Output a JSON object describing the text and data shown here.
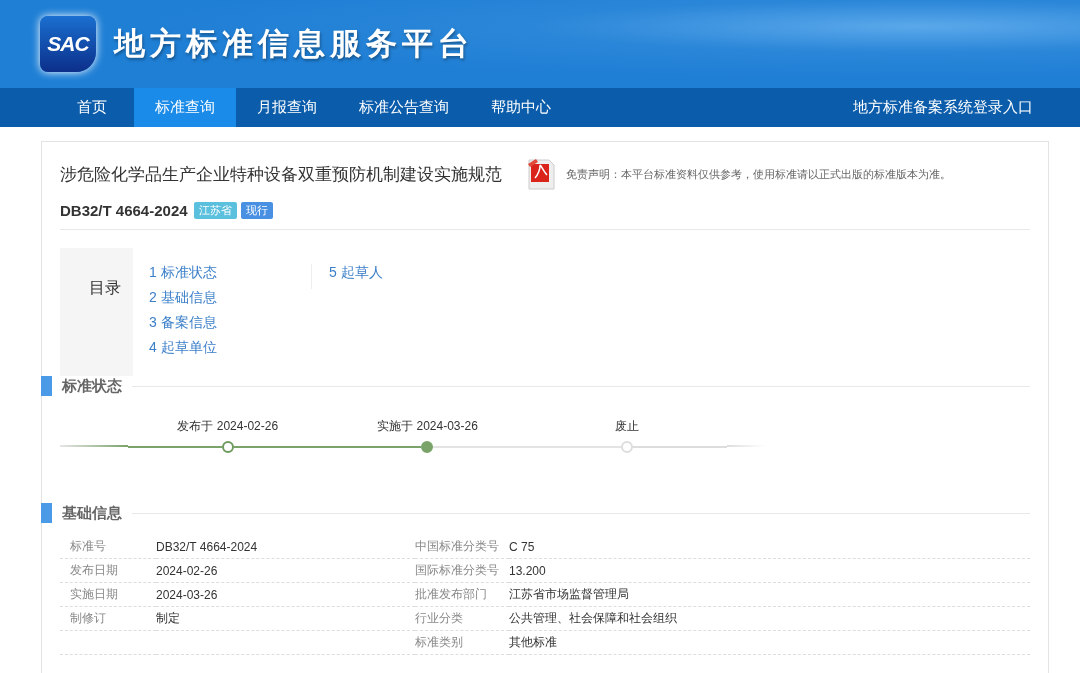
{
  "header": {
    "logo_text": "SAC",
    "title": "地方标准信息服务平台"
  },
  "nav": {
    "items": [
      {
        "label": "首页",
        "selected": false
      },
      {
        "label": "标准查询",
        "selected": true
      },
      {
        "label": "月报查询",
        "selected": false
      },
      {
        "label": "标准公告查询",
        "selected": false
      },
      {
        "label": "帮助中心",
        "selected": false
      }
    ],
    "login_link": "地方标准备案系统登录入口"
  },
  "document": {
    "title": "涉危险化学品生产企业特种设备双重预防机制建设实施规范",
    "disclaimer": "免责声明：本平台标准资料仅供参考，使用标准请以正式出版的标准版本为准。",
    "code": "DB32/T 4664-2024",
    "tags": [
      {
        "label": "江苏省",
        "color": "#5bc0de"
      },
      {
        "label": "现行",
        "color": "#4a90e2"
      }
    ]
  },
  "toc": {
    "title": "目录",
    "items": [
      "1 标准状态",
      "2 基础信息",
      "3 备案信息",
      "4 起草单位",
      "5 起草人"
    ]
  },
  "status_section": {
    "title": "标准状态",
    "steps": [
      {
        "label": "发布于 2024-02-26",
        "kind": "done"
      },
      {
        "label": "实施于 2024-03-26",
        "kind": "current"
      },
      {
        "label": "废止",
        "kind": "pending"
      }
    ]
  },
  "basic_section": {
    "title": "基础信息",
    "rows": [
      {
        "left_label": "标准号",
        "left_value": "DB32/T 4664-2024",
        "right_label": "中国标准分类号",
        "right_value": "C 75"
      },
      {
        "left_label": "发布日期",
        "left_value": "2024-02-26",
        "right_label": "国际标准分类号",
        "right_value": "13.200"
      },
      {
        "left_label": "实施日期",
        "left_value": "2024-03-26",
        "right_label": "批准发布部门",
        "right_value": "江苏省市场监督管理局"
      },
      {
        "left_label": "制修订",
        "left_value": "制定",
        "right_label": "行业分类",
        "right_value": "公共管理、社会保障和社会组织"
      },
      {
        "right_label": "标准类别",
        "right_value": "其他标准"
      }
    ]
  }
}
